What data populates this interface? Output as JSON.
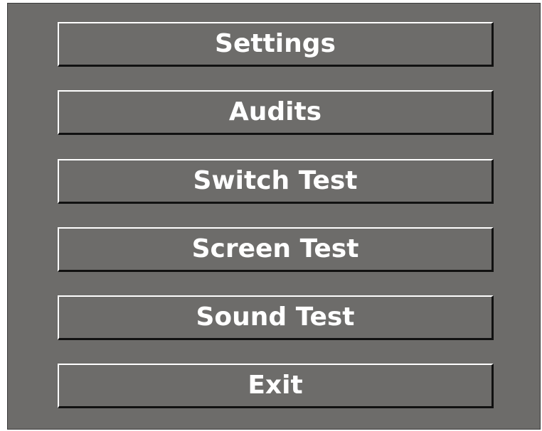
{
  "menu": {
    "items": [
      {
        "label": "Settings"
      },
      {
        "label": "Audits"
      },
      {
        "label": "Switch Test"
      },
      {
        "label": "Screen Test"
      },
      {
        "label": "Sound Test"
      },
      {
        "label": "Exit"
      }
    ]
  },
  "colors": {
    "panel_background": "#6d6c6a",
    "button_text": "#ffffff",
    "bevel_light": "#ffffff",
    "bevel_dark": "#111111"
  }
}
